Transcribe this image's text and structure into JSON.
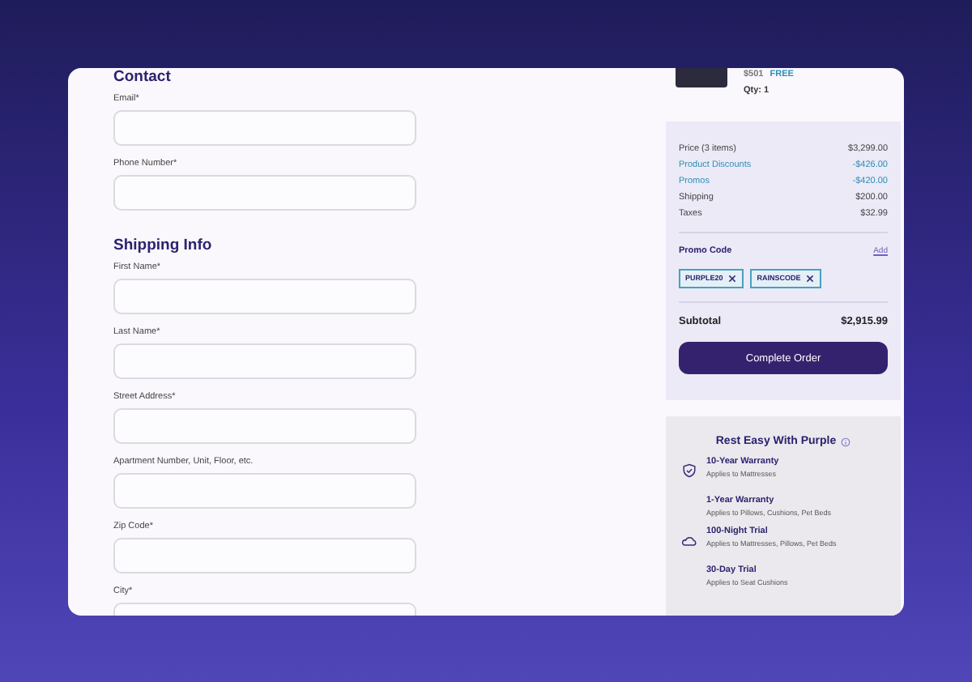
{
  "contact": {
    "heading": "Contact",
    "fields": [
      {
        "label": "Email*"
      },
      {
        "label": "Phone Number*"
      }
    ]
  },
  "shipping": {
    "heading": "Shipping Info",
    "fields": [
      {
        "label": "First Name*"
      },
      {
        "label": "Last Name*"
      },
      {
        "label": "Street Address*"
      },
      {
        "label": "Apartment Number, Unit, Floor, etc."
      },
      {
        "label": "Zip Code*"
      },
      {
        "label": "City*"
      }
    ]
  },
  "cart_item": {
    "price": "$501",
    "shipping": "FREE",
    "quantity": "Qty: 1"
  },
  "summary": {
    "lines": [
      {
        "label": "Price (3 items)",
        "amount": "$3,299.00",
        "kind": "normal"
      },
      {
        "label": "Product Discounts",
        "amount": "-$426.00",
        "kind": "discount"
      },
      {
        "label": "Promos",
        "amount": "-$420.00",
        "kind": "discount"
      },
      {
        "label": "Shipping",
        "amount": "$200.00",
        "kind": "normal"
      },
      {
        "label": "Taxes",
        "amount": "$32.99",
        "kind": "normal"
      }
    ],
    "promo_label": "Promo Code",
    "promo_add": "Add",
    "promo_codes": [
      "PURPLE20",
      "RAINSCODE"
    ],
    "subtotal_label": "Subtotal",
    "subtotal": "$2,915.99",
    "button": "Complete Order"
  },
  "guarantees": {
    "title": "Rest Easy With Purple",
    "items": [
      {
        "kind": "shield",
        "title": "10-Year Warranty",
        "subtitle": "Applies to Mattresses"
      },
      {
        "kind": "plain",
        "title": "1-Year Warranty",
        "subtitle": "Applies to Pillows, Cushions, Pet Beds"
      },
      {
        "kind": "trial",
        "title": "100-Night Trial",
        "subtitle": "Applies to Mattresses, Pillows, Pet Beds"
      },
      {
        "kind": "plain",
        "title": "30-Day Trial",
        "subtitle": "Applies to Seat Cushions"
      }
    ]
  }
}
